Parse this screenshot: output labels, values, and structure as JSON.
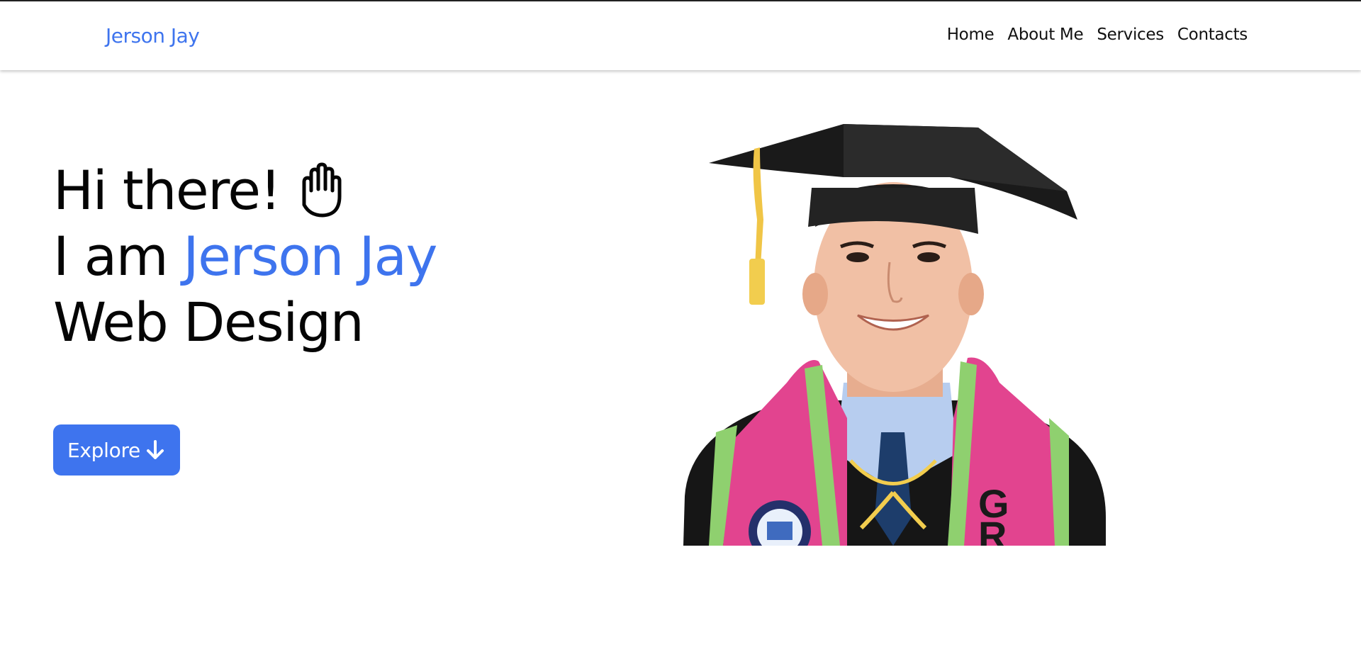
{
  "nav": {
    "brand": "Jerson Jay",
    "links": [
      "Home",
      "About Me",
      "Services",
      "Contacts"
    ]
  },
  "hero": {
    "greeting": "Hi there!",
    "intro_prefix": "I am",
    "name": "Jerson Jay",
    "role": "Web Design",
    "button_label": "Explore",
    "greeting_icon": "hand-wave-icon",
    "button_icon": "arrow-down-icon"
  },
  "portrait": {
    "stole_letters": "GR"
  },
  "colors": {
    "accent": "#3e74ee",
    "text": "#050505",
    "background": "#ffffff"
  }
}
